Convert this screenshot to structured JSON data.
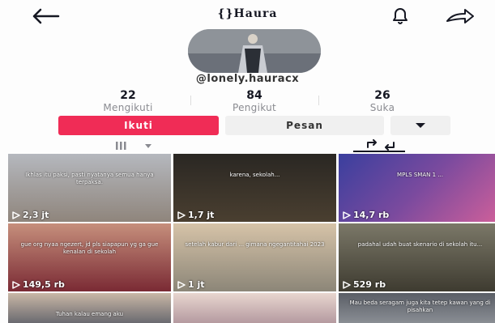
{
  "header": {
    "title": "{}Haura"
  },
  "profile": {
    "handle": "@lonely.hauracx"
  },
  "stats": [
    {
      "value": "22",
      "label": "Mengikuti"
    },
    {
      "value": "84",
      "label": "Pengikut"
    },
    {
      "value": "26",
      "label": "Suka"
    }
  ],
  "actions": {
    "follow": "Ikuti",
    "message": "Pesan"
  },
  "videos": [
    {
      "caption": "Ikhlas itu paksi, pasti nyatanya semua hanya terpaksa.",
      "views": "2,3 jt"
    },
    {
      "caption": "karena, sekolah...",
      "views": "1,7 jt"
    },
    {
      "caption": "MPLS SMAN 1 ...",
      "views": "14,7 rb"
    },
    {
      "caption": "gue org nyaa ngezert, jd pls siapapun yg ga gue kenalan di sekolah",
      "views": "149,5 rb"
    },
    {
      "caption": "setelah kabur dari ... gimana ngegantitahai 2023",
      "views": "1 jt"
    },
    {
      "caption": "padahal udah buat skenario di sekolah itu...",
      "views": "529 rb"
    },
    {
      "caption": "Tuhan kalau emang aku",
      "views": ""
    },
    {
      "caption": "",
      "views": ""
    },
    {
      "caption": "Mau beda seragam juga kita tetep kawan yang di pisahkan",
      "views": ""
    }
  ]
}
